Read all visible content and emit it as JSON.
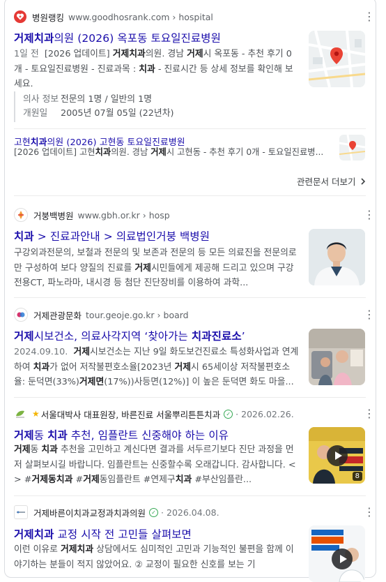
{
  "colors": {
    "link": "#1a0dab",
    "snippet": "#4d5156",
    "meta": "#70757a",
    "verified": "#34a853"
  },
  "r1": {
    "site_name": "병원랭킹",
    "site_url": "www.goodhosrank.com › hospital",
    "title_pre": "",
    "title_bold": "거제치과",
    "title_post": "의원 (2026) 옥포동 토요일진료병원",
    "snippet": {
      "date": "1일 전",
      "t1": "[2026 업데이트] ",
      "b1": "거제치과",
      "t2": "의원. 경남 ",
      "b2": "거제",
      "t3": "시 옥포동 - 추천 후기 0개 - 토요일진료병원 - 진료과목 : ",
      "b3": "치과",
      "t4": " - 진료시간 등 상세 정보를 확인해 보세요."
    },
    "meta": [
      {
        "label": "의사 정보",
        "value": "전문의 1명 / 일반의 1명"
      },
      {
        "label": "개원일",
        "value": "2005년 07월 05일 (22년차)"
      }
    ],
    "sub": {
      "title_pre": "고현",
      "title_bold": "치과",
      "title_post": "의원 (2026) 고현동 토요일진료병원",
      "t1": "[2026 업데이트] 고현",
      "b1": "치과",
      "t2": "의원. 경남 ",
      "b2": "거제",
      "t3": "시 고현동 - 추천 후기 0개 - 토요일진료병..."
    },
    "more": "관련문서 더보기"
  },
  "r2": {
    "site_name": "거붕백병원",
    "site_url": "www.gbh.or.kr › hosp",
    "title_bold": "치과",
    "title_post": " > 진료과안내 > 의료법인거붕 백병원",
    "t1": "구강외과전문의, 보철과 전문의 및 보존과 전문의 등 모든 의료진을 전문의로만 구성하여 보다 양질의 진료를 ",
    "b1": "거제",
    "t2": "시민들에게 제공해 드리고 있으며 구강전용CT, 파노라마, 내시경 등 첨단 진단장비를 이용하여 과학..."
  },
  "r3": {
    "site_name": "거제관광문화",
    "site_url": "tour.geoje.go.kr › board",
    "title_b1": "거제",
    "title_t1": "시보건소, 의료사각지역 ‘찾아가는 ",
    "title_b2": "치과진료소",
    "title_t2": "’",
    "date": "2024.09.10.",
    "b1": "거제",
    "t1": "시보건소는 지난 9일 화도보건진료소 특성화사업과 연계하여 ",
    "b2": "치과",
    "t2": "가 없어 저작불편호소율[2023년 ",
    "b3": "거제",
    "t3": "시 65세이상 저작불편호소율: 둔덕면(33%)",
    "b4": "거제면",
    "t4": "(17%))사등면(12%)] 이 높은 둔덕면 화도 마을..."
  },
  "r4": {
    "site_name": "서울대박사 대표원장, 바른진료 서울뿌리튼튼치과",
    "date": "2026.02.26.",
    "title_b1": "거제",
    "title_t1": "동 ",
    "title_b2": "치과",
    "title_t2": " 추천, 임플란트 신중해야 하는 이유",
    "b1": "거제",
    "t1": "동 ",
    "b2": "치과",
    "t2": " 추천을 고민하고 계신다면 결과를 서두르기보다 진단 과정을 먼저 살펴보시길 바랍니다. 임플란트는 신중할수록 오래갑니다. 감사합니다. < > #",
    "b3": "거제동치과",
    "t3": " #",
    "b4": "거제",
    "t4": "동임플란트 #연제구",
    "b5": "치과",
    "t5": " #부산임플란...",
    "badge": "8"
  },
  "r5": {
    "site_name": "거제바른이치과교정과치과의원",
    "date": "2026.04.08.",
    "title_b1": "거제치과",
    "title_t1": " 교정 시작 전 고민들 살펴보면",
    "t1": "이런 이유로 ",
    "b1": "거제치과",
    "t2": " 상담에서도 심미적인 고민과 기능적인 불편을 함께 이야기하는 분들이 적지 않았어요. ② 교정이 필요한 신호를 보는 기"
  },
  "icons": {
    "more": "three-dots-vertical-icon",
    "chevron": "chevron-right-icon",
    "verified": "verified-check-icon",
    "play": "play-icon"
  }
}
